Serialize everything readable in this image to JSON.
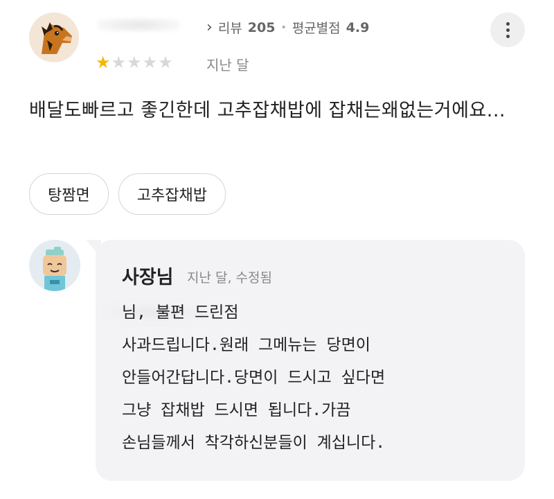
{
  "review": {
    "review_count_label": "리뷰",
    "review_count": "205",
    "avg_rating_label": "평균별점",
    "avg_rating": "4.9",
    "rating": 1,
    "max_rating": 5,
    "date": "지난 달",
    "text": "배달도빠르고 좋긴한데 고추잡채밥에 잡채는왜없는거에요...",
    "tags": [
      "탕짬면",
      "고추잡채밥"
    ]
  },
  "owner_reply": {
    "name": "사장님",
    "meta": "지난 달, 수정됨",
    "text": "님, 불편 드린점\n사과드립니다.원래 그메뉴는 당면이\n안들어간답니다.당면이 드시고 싶다면\n그냥 잡채밥 드시면 됩니다.가끔\n손님들께서 착각하신분들이 계십니다."
  },
  "colors": {
    "star_on": "#f5b800",
    "star_off": "#d8d8d8",
    "bubble_bg": "#f3f3f5"
  },
  "icons": {
    "more": "more-vertical-icon",
    "chevron": "chevron-right-icon",
    "star": "star-icon"
  }
}
